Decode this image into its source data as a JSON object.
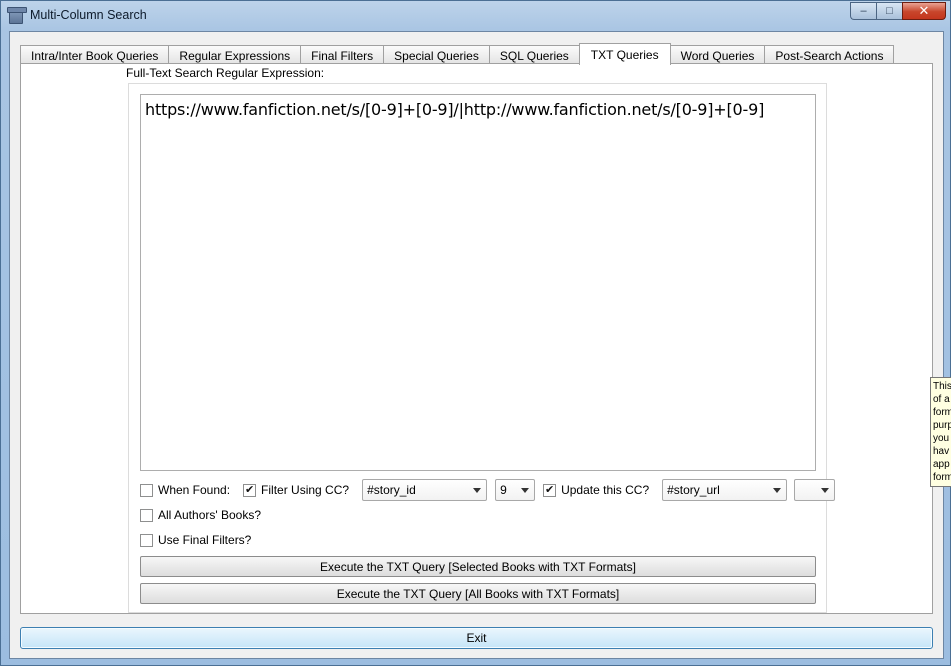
{
  "window": {
    "title": "Multi-Column Search",
    "minimize": "–",
    "maximize": "□",
    "close": "✕"
  },
  "tabs": [
    {
      "label": "Intra/Inter Book Queries"
    },
    {
      "label": "Regular Expressions"
    },
    {
      "label": "Final Filters"
    },
    {
      "label": "Special Queries"
    },
    {
      "label": "SQL Queries"
    },
    {
      "label": "TXT Queries",
      "active": true
    },
    {
      "label": "Word Queries"
    },
    {
      "label": "Post-Search Actions"
    }
  ],
  "txt_panel": {
    "regex_label": "Full-Text Search Regular Expression:",
    "regex_value": "https://www.fanfiction.net/s/[0-9]+[0-9]/|http://www.fanfiction.net/s/[0-9]+[0-9]",
    "when_found": {
      "label": "When Found:",
      "checked": false
    },
    "filter_using_cc": {
      "label": "Filter Using CC?",
      "checked": true
    },
    "filter_column": "#story_id",
    "filter_value": "9",
    "update_cc": {
      "label": "Update this CC?",
      "checked": true
    },
    "update_column": "#story_url",
    "update_extra": "",
    "all_authors": {
      "label": "All Authors' Books?",
      "checked": false
    },
    "use_final_filters": {
      "label": "Use Final Filters?",
      "checked": false
    },
    "exec_selected": "Execute the TXT Query [Selected Books with TXT Formats]",
    "exec_all": "Execute the TXT Query [All Books with TXT Formats]"
  },
  "exit_label": "Exit",
  "tooltip_lines": [
    "This",
    "of a",
    "form",
    "purp",
    "you",
    "hav",
    "app",
    "form"
  ]
}
